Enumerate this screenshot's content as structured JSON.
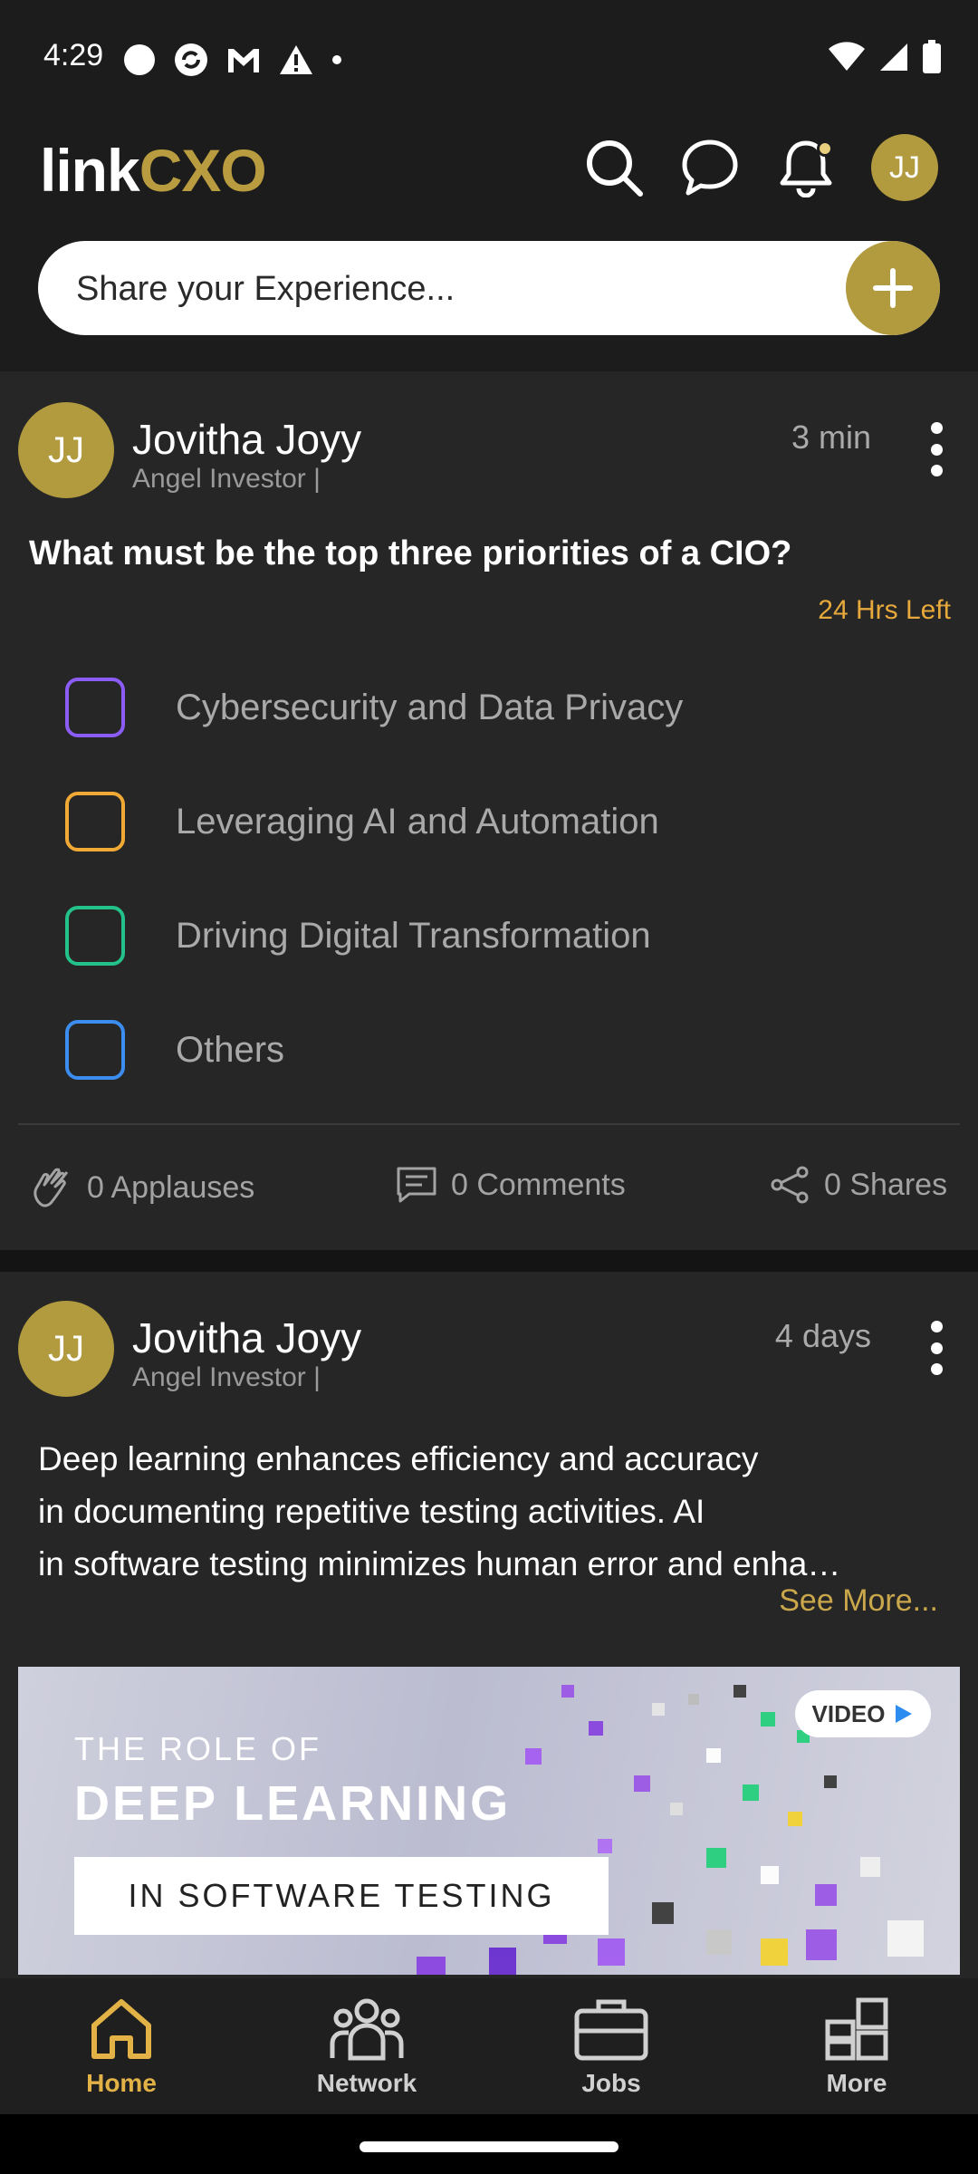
{
  "status_bar": {
    "time": "4:29"
  },
  "header": {
    "logo_link": "link",
    "logo_cxo": "CXO",
    "user_initials": "JJ"
  },
  "share": {
    "placeholder": "Share your Experience..."
  },
  "posts": [
    {
      "author_initials": "JJ",
      "author_name": "Jovitha Joyy",
      "author_title": "Angel Investor |",
      "time": "3 min",
      "poll": {
        "question": "What must be the top three priorities of a CIO?",
        "remaining": "24 Hrs Left",
        "options": [
          {
            "label": "Cybersecurity and Data Privacy",
            "color": "#8b5cf6"
          },
          {
            "label": "Leveraging AI and Automation",
            "color": "#f0a935"
          },
          {
            "label": "Driving Digital Transformation",
            "color": "#22c28a"
          },
          {
            "label": "Others",
            "color": "#3b8ef0"
          }
        ]
      },
      "applauses": "0 Applauses",
      "comments": "0 Comments",
      "shares": "0 Shares"
    },
    {
      "author_initials": "JJ",
      "author_name": "Jovitha Joyy",
      "author_title": "Angel Investor |",
      "time": "4 days",
      "body_line1": "Deep learning enhances efficiency and accuracy",
      "body_line2": "in documenting repetitive testing activities. AI",
      "body_line3": "in software testing minimizes human error and enha…",
      "see_more": "See More...",
      "image": {
        "line1": "THE ROLE OF",
        "line2": "DEEP LEARNING",
        "line3": "IN SOFTWARE TESTING",
        "badge": "VIDEO"
      }
    }
  ],
  "bottom_nav": [
    {
      "label": "Home",
      "active": true
    },
    {
      "label": "Network",
      "active": false
    },
    {
      "label": "Jobs",
      "active": false
    },
    {
      "label": "More",
      "active": false
    }
  ],
  "colors": {
    "brand_gold": "#b29a3f",
    "active_nav": "#e2b247",
    "time_left": "#e7a93b"
  }
}
